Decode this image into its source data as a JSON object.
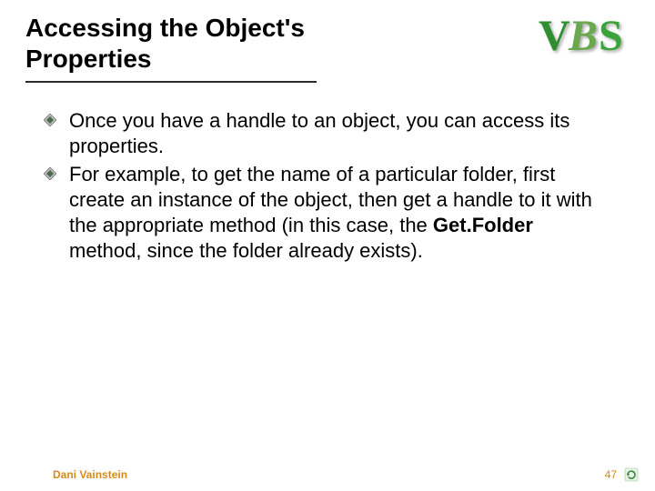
{
  "header": {
    "title": "Accessing the Object's Properties",
    "logo": {
      "v": "V",
      "b": "B",
      "s": "S",
      "name": "VBS"
    }
  },
  "bullets": [
    {
      "text": "Once you have a handle to an object, you can access its properties."
    },
    {
      "text_before": "For example, to get the name of a particular folder, first create an instance of the object, then get a handle to it with the appropriate method (in this case, the ",
      "bold": "Get.Folder",
      "text_after": " method, since the folder already exists)."
    }
  ],
  "footer": {
    "author": "Dani Vainstein",
    "page": "47"
  }
}
